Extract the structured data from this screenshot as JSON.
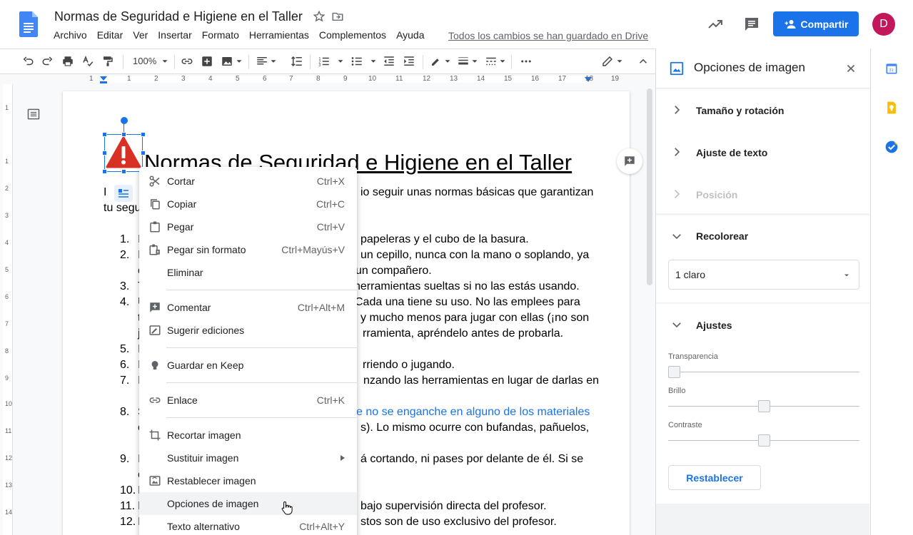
{
  "header": {
    "title": "Normas de Seguridad e Higiene en el Taller",
    "menus": [
      "Archivo",
      "Editar",
      "Ver",
      "Insertar",
      "Formato",
      "Herramientas",
      "Complementos",
      "Ayuda"
    ],
    "saved_status": "Todos los cambios se han guardado en Drive",
    "share_label": "Compartir",
    "avatar_initial": "D"
  },
  "toolbar": {
    "zoom": "100%"
  },
  "ruler": {
    "numbers": [
      "1",
      "1",
      "2",
      "3",
      "4",
      "5",
      "6",
      "7",
      "8",
      "9",
      "10",
      "11",
      "12",
      "13",
      "14",
      "15",
      "16",
      "17",
      "18",
      "19"
    ]
  },
  "document": {
    "heading": "Normas de Seguridad e Higiene en el Taller",
    "intro_line1_start": "I",
    "intro_line1_end": "io seguir unas normas básicas que garantizan",
    "intro_line2": "tu segu",
    "list": [
      {
        "num": "1.",
        "a": "I",
        "b": "papeleras y el cubo de la basura."
      },
      {
        "num": "2.",
        "a": "I",
        "b": "un cepillo, nunca con la mano o soplando, ya"
      },
      {
        "num": "",
        "a": "c",
        "b": "un compañero."
      },
      {
        "num": "3.",
        "a": "T",
        "b": "herramientas sueltas si no las estás usando."
      },
      {
        "num": "4.",
        "a": "U",
        "b": "Cada una tiene su uso. No las emplees para"
      },
      {
        "num": "",
        "a": "t",
        "b": "y mucho menos para jugar con ellas (¡no son"
      },
      {
        "num": "",
        "a": "j",
        "b": "rramienta, apréndelo antes de probarla."
      },
      {
        "num": "5.",
        "a": "I",
        "b": ""
      },
      {
        "num": "6.",
        "a": "I",
        "b": "rriendo o jugando."
      },
      {
        "num": "7.",
        "a": "I",
        "b": "nzando las herramientas en lugar de darlas en"
      },
      {
        "num": "8.",
        "a": "S",
        "b": "e no se enganche en alguno de los materiales"
      },
      {
        "num": "",
        "a": "c",
        "b": "s). Lo mismo ocurre con bufandas, pañuelos,"
      },
      {
        "num": "9.",
        "a": "I",
        "b": "á cortando, ni pases por delante de él. Si se"
      },
      {
        "num": "",
        "a": "c",
        "b": ""
      },
      {
        "num": "10.",
        "a": "I",
        "b": ""
      },
      {
        "num": "11.",
        "a": "I",
        "b": "bajo supervisión directa del profesor."
      },
      {
        "num": "12.",
        "a": "I",
        "b": "stos son de uso exclusivo del profesor."
      }
    ]
  },
  "context_menu": {
    "items": [
      {
        "label": "Cortar",
        "shortcut": "Ctrl+X",
        "icon": "scissors-icon"
      },
      {
        "label": "Copiar",
        "shortcut": "Ctrl+C",
        "icon": "copy-icon"
      },
      {
        "label": "Pegar",
        "shortcut": "Ctrl+V",
        "icon": "paste-icon"
      },
      {
        "label": "Pegar sin formato",
        "shortcut": "Ctrl+Mayús+V",
        "icon": "paste-plain-icon"
      },
      {
        "label": "Eliminar",
        "shortcut": "",
        "icon": ""
      },
      {
        "label": "Comentar",
        "shortcut": "Ctrl+Alt+M",
        "icon": "comment-add-icon"
      },
      {
        "label": "Sugerir ediciones",
        "shortcut": "",
        "icon": "suggest-edit-icon"
      },
      {
        "label": "Guardar en Keep",
        "shortcut": "",
        "icon": "keep-bulb-icon"
      },
      {
        "label": "Enlace",
        "shortcut": "Ctrl+K",
        "icon": "link-icon"
      },
      {
        "label": "Recortar imagen",
        "shortcut": "",
        "icon": "crop-icon"
      },
      {
        "label": "Sustituir imagen",
        "shortcut": "",
        "icon": ""
      },
      {
        "label": "Restablecer imagen",
        "shortcut": "",
        "icon": "reset-image-icon"
      },
      {
        "label": "Opciones de imagen",
        "shortcut": "",
        "icon": ""
      },
      {
        "label": "Texto alternativo",
        "shortcut": "Ctrl+Alt+Y",
        "icon": ""
      }
    ]
  },
  "side_panel": {
    "title": "Opciones de imagen",
    "sections": [
      "Tamaño y rotación",
      "Ajuste de texto",
      "Posición",
      "Recolorear",
      "Ajustes"
    ],
    "recolor_value": "1 claro",
    "sliders": [
      {
        "label": "Transparencia",
        "value": 0
      },
      {
        "label": "Brillo",
        "value": 0.5
      },
      {
        "label": "Contraste",
        "value": 0.5
      }
    ],
    "reset_label": "Restablecer"
  },
  "colors": {
    "accent": "#1a73e8",
    "avatar": "#c2185b",
    "warning": "#d93025"
  }
}
